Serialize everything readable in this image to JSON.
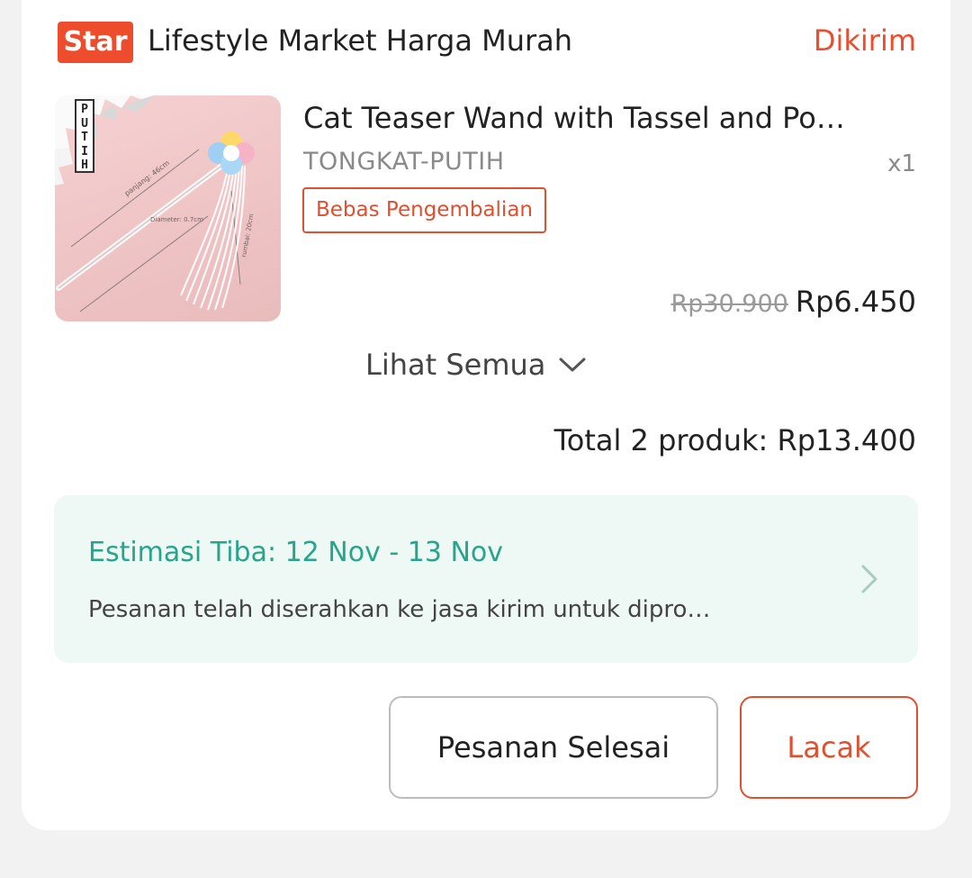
{
  "shop": {
    "badge": "Star",
    "name": "Lifestyle Market Harga Murah",
    "status": "Dikirim"
  },
  "product": {
    "image_tag": [
      "P",
      "U",
      "T",
      "I",
      "H"
    ],
    "title": "Cat Teaser Wand with Tassel and Po…",
    "variant": "TONGKAT-PUTIH",
    "quantity": "x1",
    "returns_label": "Bebas Pengembalian",
    "price_original": "Rp30.900",
    "price_current": "Rp6.450"
  },
  "see_all_label": "Lihat Semua",
  "total_label": "Total 2 produk: Rp13.400",
  "delivery": {
    "eta": "Estimasi Tiba: 12 Nov - 13 Nov",
    "description": "Pesanan telah diserahkan ke jasa kirim untuk dipro…"
  },
  "actions": {
    "complete_label": "Pesanan Selesai",
    "track_label": "Lacak"
  },
  "colors": {
    "accent": "#ee4d2d",
    "delivery_text": "#26a58a",
    "delivery_bg": "#eef8f4"
  },
  "icons": {
    "see_all": "chevron-down-icon",
    "delivery": "chevron-right-icon"
  }
}
